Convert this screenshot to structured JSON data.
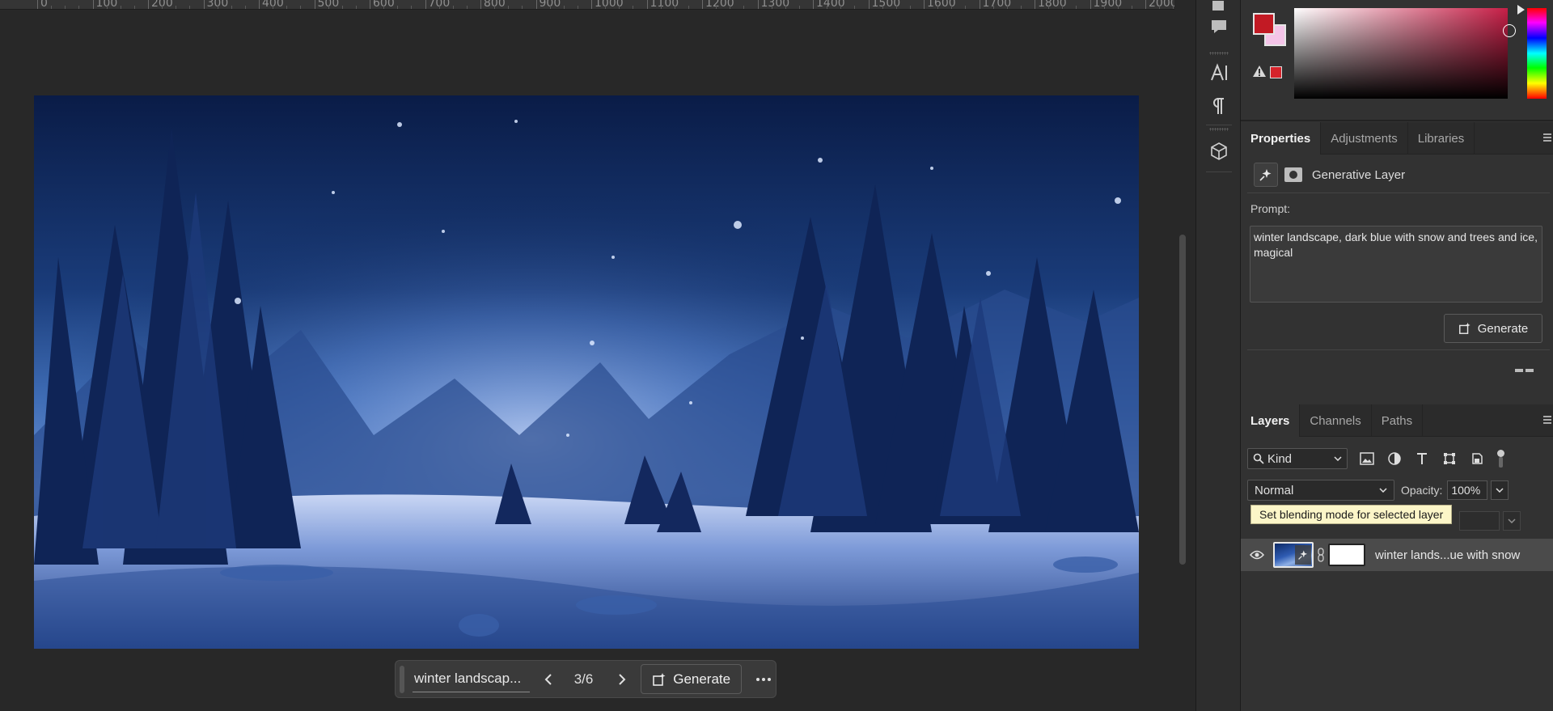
{
  "ruler": {
    "marks": [
      "0",
      "100",
      "200",
      "300",
      "400",
      "500",
      "600",
      "700",
      "800",
      "900",
      "1000",
      "1100",
      "1200",
      "1300",
      "1400",
      "1500",
      "1600",
      "1700",
      "1800",
      "1900",
      "2000"
    ]
  },
  "taskbar": {
    "prompt_text": "winter landscap...",
    "variation_counter": "3/6",
    "generate_label": "Generate"
  },
  "colors": {
    "foreground": "#c21a24",
    "background": "#f4c4e8",
    "accent_hue": "#c71f47"
  },
  "properties": {
    "tabs": [
      {
        "label": "Properties",
        "active": true
      },
      {
        "label": "Adjustments",
        "active": false
      },
      {
        "label": "Libraries",
        "active": false
      }
    ],
    "layer_type": "Generative Layer",
    "prompt_label": "Prompt:",
    "prompt_value": "winter landscape, dark blue with snow and trees and ice, magical",
    "generate_label": "Generate"
  },
  "layers": {
    "tabs": [
      {
        "label": "Layers",
        "active": true
      },
      {
        "label": "Channels",
        "active": false
      },
      {
        "label": "Paths",
        "active": false
      }
    ],
    "filter_kind": "Kind",
    "blend_mode": "Normal",
    "opacity_label": "Opacity:",
    "opacity_value": "100%",
    "tooltip": "Set blending mode for selected layer",
    "items": [
      {
        "name": "winter lands...ue with snow",
        "visible": true
      }
    ]
  }
}
